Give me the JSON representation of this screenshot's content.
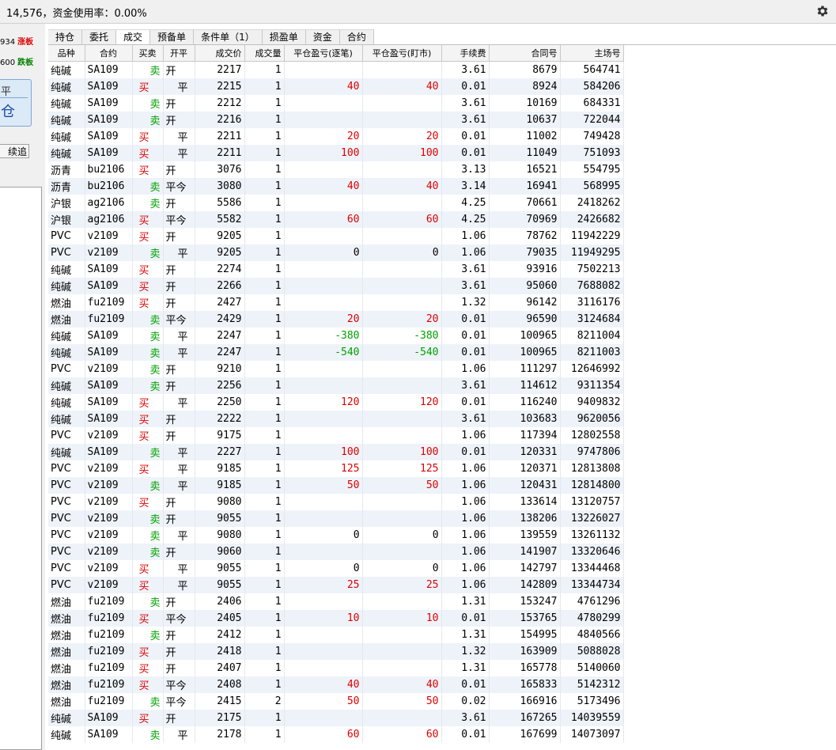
{
  "top_bar": {
    "title": "14,576，资金使用率：0.00%",
    "settings_icon": "gear-icon"
  },
  "left_panel": {
    "rows": [
      {
        "num": "934",
        "badge": "涨板",
        "kind": "up"
      },
      {
        "num": "600",
        "badge": "跌板",
        "kind": "dn"
      }
    ],
    "button_top": "平",
    "button_bottom": "仓",
    "small_button": "续追"
  },
  "tabs": [
    "持仓",
    "委托",
    "成交",
    "预备单",
    "条件单（1）",
    "损盈单",
    "资金",
    "合约"
  ],
  "active_tab": "成交",
  "columns": [
    "品种",
    "合约",
    "买卖",
    "开平",
    "成交价",
    "成交量",
    "平仓盈亏(逐笔)",
    "平仓盈亏(盯市)",
    "手续费",
    "合同号",
    "主场号"
  ],
  "rows": [
    [
      "纯碱",
      "SA109",
      "卖",
      "开",
      "2217",
      "1",
      "",
      "",
      "3.61",
      "8679",
      "564741"
    ],
    [
      "纯碱",
      "SA109",
      "买",
      "平",
      "2215",
      "1",
      "40",
      "40",
      "0.01",
      "8924",
      "584206"
    ],
    [
      "纯碱",
      "SA109",
      "卖",
      "开",
      "2212",
      "1",
      "",
      "",
      "3.61",
      "10169",
      "684331"
    ],
    [
      "纯碱",
      "SA109",
      "卖",
      "开",
      "2216",
      "1",
      "",
      "",
      "3.61",
      "10637",
      "722044"
    ],
    [
      "纯碱",
      "SA109",
      "买",
      "平",
      "2211",
      "1",
      "20",
      "20",
      "0.01",
      "11002",
      "749428"
    ],
    [
      "纯碱",
      "SA109",
      "买",
      "平",
      "2211",
      "1",
      "100",
      "100",
      "0.01",
      "11049",
      "751093"
    ],
    [
      "沥青",
      "bu2106",
      "买",
      "开",
      "3076",
      "1",
      "",
      "",
      "3.13",
      "16521",
      "554795"
    ],
    [
      "沥青",
      "bu2106",
      "卖",
      "平今",
      "3080",
      "1",
      "40",
      "40",
      "3.14",
      "16941",
      "568995"
    ],
    [
      "沪银",
      "ag2106",
      "卖",
      "开",
      "5586",
      "1",
      "",
      "",
      "4.25",
      "70661",
      "2418262"
    ],
    [
      "沪银",
      "ag2106",
      "买",
      "平今",
      "5582",
      "1",
      "60",
      "60",
      "4.25",
      "70969",
      "2426682"
    ],
    [
      "PVC",
      "v2109",
      "买",
      "开",
      "9205",
      "1",
      "",
      "",
      "1.06",
      "78762",
      "11942229"
    ],
    [
      "PVC",
      "v2109",
      "卖",
      "平",
      "9205",
      "1",
      "0",
      "0",
      "1.06",
      "79035",
      "11949295"
    ],
    [
      "纯碱",
      "SA109",
      "买",
      "开",
      "2274",
      "1",
      "",
      "",
      "3.61",
      "93916",
      "7502213"
    ],
    [
      "纯碱",
      "SA109",
      "买",
      "开",
      "2266",
      "1",
      "",
      "",
      "3.61",
      "95060",
      "7688082"
    ],
    [
      "燃油",
      "fu2109",
      "买",
      "开",
      "2427",
      "1",
      "",
      "",
      "1.32",
      "96142",
      "3116176"
    ],
    [
      "燃油",
      "fu2109",
      "卖",
      "平今",
      "2429",
      "1",
      "20",
      "20",
      "0.01",
      "96590",
      "3124684"
    ],
    [
      "纯碱",
      "SA109",
      "卖",
      "平",
      "2247",
      "1",
      "-380",
      "-380",
      "0.01",
      "100965",
      "8211004"
    ],
    [
      "纯碱",
      "SA109",
      "卖",
      "平",
      "2247",
      "1",
      "-540",
      "-540",
      "0.01",
      "100965",
      "8211003"
    ],
    [
      "PVC",
      "v2109",
      "卖",
      "开",
      "9210",
      "1",
      "",
      "",
      "1.06",
      "111297",
      "12646992"
    ],
    [
      "纯碱",
      "SA109",
      "卖",
      "开",
      "2256",
      "1",
      "",
      "",
      "3.61",
      "114612",
      "9311354"
    ],
    [
      "纯碱",
      "SA109",
      "买",
      "平",
      "2250",
      "1",
      "120",
      "120",
      "0.01",
      "116240",
      "9409832"
    ],
    [
      "纯碱",
      "SA109",
      "买",
      "开",
      "2222",
      "1",
      "",
      "",
      "3.61",
      "103683",
      "9620056"
    ],
    [
      "PVC",
      "v2109",
      "买",
      "开",
      "9175",
      "1",
      "",
      "",
      "1.06",
      "117394",
      "12802558"
    ],
    [
      "纯碱",
      "SA109",
      "卖",
      "平",
      "2227",
      "1",
      "100",
      "100",
      "0.01",
      "120331",
      "9747806"
    ],
    [
      "PVC",
      "v2109",
      "买",
      "平",
      "9185",
      "1",
      "125",
      "125",
      "1.06",
      "120371",
      "12813808"
    ],
    [
      "PVC",
      "v2109",
      "卖",
      "平",
      "9185",
      "1",
      "50",
      "50",
      "1.06",
      "120431",
      "12814800"
    ],
    [
      "PVC",
      "v2109",
      "买",
      "开",
      "9080",
      "1",
      "",
      "",
      "1.06",
      "133614",
      "13120757"
    ],
    [
      "PVC",
      "v2109",
      "卖",
      "开",
      "9055",
      "1",
      "",
      "",
      "1.06",
      "138206",
      "13226027"
    ],
    [
      "PVC",
      "v2109",
      "卖",
      "平",
      "9080",
      "1",
      "0",
      "0",
      "1.06",
      "139559",
      "13261132"
    ],
    [
      "PVC",
      "v2109",
      "卖",
      "开",
      "9060",
      "1",
      "",
      "",
      "1.06",
      "141907",
      "13320646"
    ],
    [
      "PVC",
      "v2109",
      "买",
      "平",
      "9055",
      "1",
      "0",
      "0",
      "1.06",
      "142797",
      "13344468"
    ],
    [
      "PVC",
      "v2109",
      "买",
      "平",
      "9055",
      "1",
      "25",
      "25",
      "1.06",
      "142809",
      "13344734"
    ],
    [
      "燃油",
      "fu2109",
      "卖",
      "开",
      "2406",
      "1",
      "",
      "",
      "1.31",
      "153247",
      "4761296"
    ],
    [
      "燃油",
      "fu2109",
      "买",
      "平今",
      "2405",
      "1",
      "10",
      "10",
      "0.01",
      "153765",
      "4780299"
    ],
    [
      "燃油",
      "fu2109",
      "卖",
      "开",
      "2412",
      "1",
      "",
      "",
      "1.31",
      "154995",
      "4840566"
    ],
    [
      "燃油",
      "fu2109",
      "买",
      "开",
      "2418",
      "1",
      "",
      "",
      "1.32",
      "163909",
      "5088028"
    ],
    [
      "燃油",
      "fu2109",
      "买",
      "开",
      "2407",
      "1",
      "",
      "",
      "1.31",
      "165778",
      "5140060"
    ],
    [
      "燃油",
      "fu2109",
      "买",
      "平今",
      "2408",
      "1",
      "40",
      "40",
      "0.01",
      "165833",
      "5142312"
    ],
    [
      "燃油",
      "fu2109",
      "卖",
      "平今",
      "2415",
      "2",
      "50",
      "50",
      "0.02",
      "166916",
      "5173496"
    ],
    [
      "纯碱",
      "SA109",
      "买",
      "开",
      "2175",
      "1",
      "",
      "",
      "3.61",
      "167265",
      "14039559"
    ],
    [
      "纯碱",
      "SA109",
      "卖",
      "平",
      "2178",
      "1",
      "60",
      "60",
      "0.01",
      "167699",
      "14073097"
    ]
  ],
  "colors": {
    "buy": "#e00000",
    "sell": "#00a000",
    "alt_row": "#eef3f9"
  }
}
